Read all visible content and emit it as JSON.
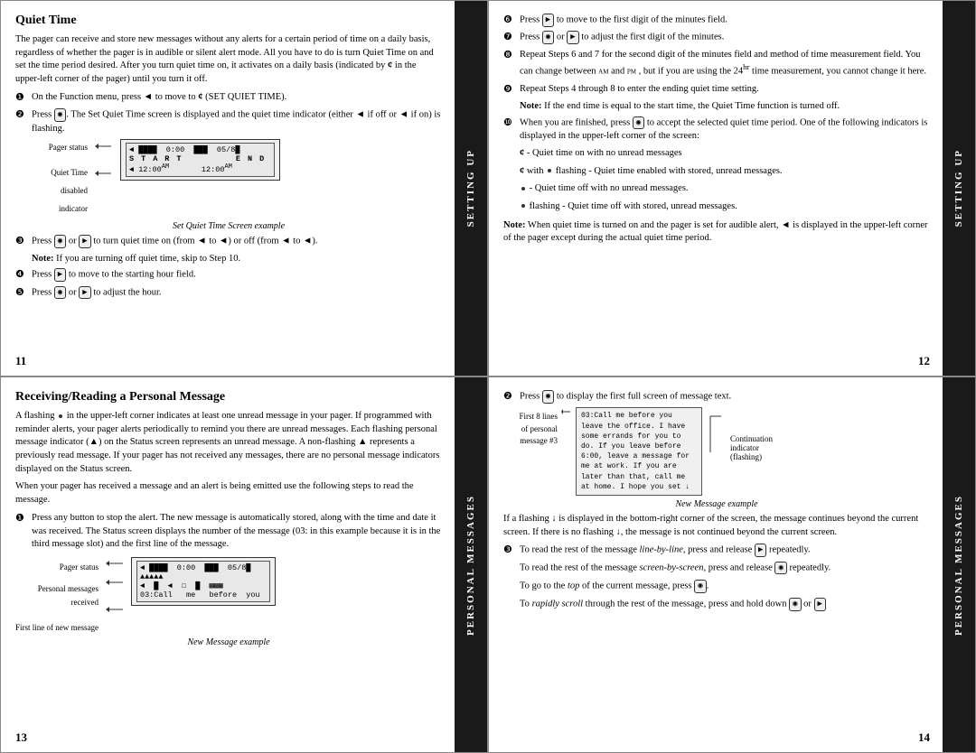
{
  "panels": {
    "top_left": {
      "title": "Quiet Time",
      "page_number": "11",
      "tab_label": "SETTING UP",
      "intro": "The pager can receive and store new messages without any alerts for a certain period of time on a daily basis, regardless of whether the pager is in audible or silent alert mode. All you have to do is turn Quiet Time on and set the time period desired. After you turn quiet time on, it activates on a daily basis (indicated by ¢ in the upper-left corner of the pager) until you turn it off.",
      "steps": [
        {
          "num": "❶",
          "text": "On the Function menu, press ◄ to move to ¢ (SET QUIET TIME)."
        },
        {
          "num": "❷",
          "text": "Press ◉. The Set Quiet Time screen is displayed and the quiet time indicator (either ◄ if off or ◄ if on) is flashing."
        },
        {
          "num": "❸",
          "text": "Press ◉ or ▶ to turn quiet time on (from ◄ to ◄) or off (from ◄ to ◄).",
          "note": "Note: If you are turning off quiet time, skip to Step 10."
        },
        {
          "num": "❹",
          "text": "Press ▶ to move to the starting hour field."
        },
        {
          "num": "❺",
          "text": "Press ◉ or ▶ to adjust the hour."
        }
      ],
      "screen_label": "Set Quiet Time Screen example",
      "diagram_labels": [
        "Pager status",
        "Quiet Time disabled indicator"
      ],
      "screen_line1": "◄ ▪▪▪▪  0:00  ▪▪▪  05/8▪",
      "screen_line2": "  START       END",
      "screen_line3": "◄ 12:00ᴬᴹ        12:00ᴬᴹ"
    },
    "top_right": {
      "page_number": "12",
      "tab_label": "SETTING UP",
      "steps": [
        {
          "num": "❻",
          "text": "Press ▶ to move to the first digit of the minutes field."
        },
        {
          "num": "❼",
          "text": "Press ◉ or ▶ to adjust the first digit of the minutes."
        },
        {
          "num": "❽",
          "text": "Repeat Steps 6 and 7 for the second digit of the minutes field and method of time measurement field. You can change between ᴬᴹ and ᴾᴹ , but if you are using the 24ʰʳ time measurement, you cannot change it here."
        },
        {
          "num": "❾",
          "text": "Repeat Steps 4 through 8 to enter the ending quiet time setting.",
          "note": "Note: If the end time is equal to the start time, the Quiet Time function is turned off."
        },
        {
          "num": "❿",
          "text": "When you are finished, press ◉ to accept the selected quiet time period. One of the following indicators is displayed in the upper-left corner of the screen:"
        }
      ],
      "indicators": [
        "¢ - Quiet time on with no unread messages",
        "¢ with • flashing - Quiet time enabled with stored, unread messages.",
        "• - Quiet time off with no unread messages.",
        "• flashing - Quiet time off with stored, unread messages."
      ],
      "note_final": "Note: When quiet time is turned on and the pager is set for audible alert, ◄ is displayed in the upper-left corner of the pager except during the actual quiet time period."
    },
    "bottom_left": {
      "title": "Receiving/Reading a Personal Message",
      "page_number": "13",
      "tab_label": "PERSONAL MESSAGES",
      "intro": "A flashing • in the upper-left corner indicates at least one unread message in your pager. If programmed with reminder alerts, your pager alerts periodically to remind you there are unread messages. Each flashing personal message indicator (▲) on the Status screen represents an unread message. A non-flashing ▲ represents a previously read message. If your pager has not received any messages, there are no personal message indicators displayed on the Status screen.",
      "para2": "When your pager has received a message and an alert is being emitted use the following steps to read the message.",
      "steps": [
        {
          "num": "❶",
          "text": "Press any button to stop the alert. The new message is automatically stored, along with the time and date it was received. The Status screen displays the number of the message (03: in this example because it is in the third message slot) and the first line of the message."
        }
      ],
      "diagram_labels": [
        "Pager status",
        "Personal messages received",
        "First line of new message"
      ],
      "screen_line1": "◄ ▪▪▪▪  0:00  ▪▪▪  05/8▪",
      "screen_line2": "▲▲▲▲▲",
      "screen_line3": "◄  ▪  ◄  ☐  ▪  ▦▦▦",
      "screen_line4": "03:Call   me   before  you",
      "screen_caption": "New Message example"
    },
    "bottom_right": {
      "page_number": "14",
      "tab_label": "PERSONAL MESSAGES",
      "steps": [
        {
          "num": "❷",
          "text": "Press ◉ to display the first full screen of message text."
        }
      ],
      "msg_screen_labels": [
        "First 8 lines of personal message #3"
      ],
      "msg_screen_lines": [
        "03:Call me before you",
        "leave the office. I have",
        "some errands for you to",
        "do. If you leave before",
        "6:00, leave a message for",
        "me at work. If you are",
        "later than that, call me",
        "at home. I hope you set ↓"
      ],
      "msg_screen_caption": "New Message example",
      "continuation_label": "Continuation indicator (flashing)",
      "steps2": [
        {
          "num": "❸",
          "text": "To read the rest of the message line-by-line, press and release ▶ repeatedly."
        },
        {
          "text": "To read the rest of the message screen-by-screen, press and release ◉ repeatedly."
        },
        {
          "text": "To go to the top of the current message, press ◉."
        },
        {
          "text": "To rapidly scroll through the rest of the message, press and hold down ◉ or ▶"
        }
      ],
      "flashing_note": "If a flashing ↓ is displayed in the bottom-right corner of the screen, the message continues beyond the current screen. If there is no flashing ↓, the message is not continued beyond the current screen."
    }
  }
}
